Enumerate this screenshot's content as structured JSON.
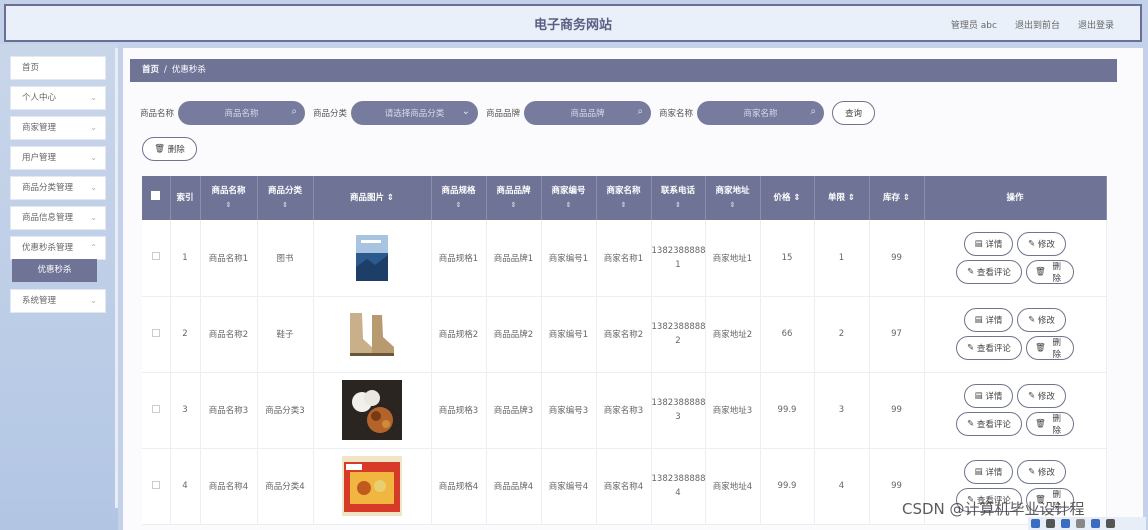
{
  "header": {
    "title": "电子商务网站",
    "admin": "管理员 abc",
    "front": "退出到前台",
    "logout": "退出登录"
  },
  "sidebar": {
    "items": [
      {
        "label": "首页",
        "chevron": false
      },
      {
        "label": "个人中心",
        "chevron": true
      },
      {
        "label": "商家管理",
        "chevron": true
      },
      {
        "label": "用户管理",
        "chevron": true
      },
      {
        "label": "商品分类管理",
        "chevron": true
      },
      {
        "label": "商品信息管理",
        "chevron": true
      },
      {
        "label": "优惠秒杀管理",
        "chevron": true
      },
      {
        "label": "系统管理",
        "chevron": true
      }
    ],
    "active_sub": "优惠秒杀"
  },
  "breadcrumb": {
    "home": "首页",
    "sep": "/",
    "current": "优惠秒杀"
  },
  "filters": {
    "name_label": "商品名称",
    "name_ph": "商品名称",
    "cat_label": "商品分类",
    "cat_ph": "请选择商品分类",
    "brand_label": "商品品牌",
    "brand_ph": "商品品牌",
    "shop_label": "商家名称",
    "shop_ph": "商家名称",
    "query": "查询"
  },
  "delete_label": "删除",
  "table": {
    "headers": {
      "index": "索引",
      "name": "商品名称",
      "cat": "商品分类",
      "img": "商品图片",
      "spec": "商品规格",
      "brand": "商品品牌",
      "shopno": "商家编号",
      "shopname": "商家名称",
      "phone": "联系电话",
      "addr": "商家地址",
      "price": "价格",
      "limit": "单限",
      "stock": "库存",
      "ops": "操作"
    },
    "rows": [
      {
        "index": "1",
        "name": "商品名称1",
        "cat": "图书",
        "spec": "商品规格1",
        "brand": "商品品牌1",
        "shopno": "商家编号1",
        "shopname": "商家名称1",
        "phone1": "1382388888",
        "phone2": "1",
        "addr": "商家地址1",
        "price": "15",
        "limit": "1",
        "stock": "99"
      },
      {
        "index": "2",
        "name": "商品名称2",
        "cat": "鞋子",
        "spec": "商品规格2",
        "brand": "商品品牌2",
        "shopno": "商家编号1",
        "shopname": "商家名称2",
        "phone1": "1382388888",
        "phone2": "2",
        "addr": "商家地址2",
        "price": "66",
        "limit": "2",
        "stock": "97"
      },
      {
        "index": "3",
        "name": "商品名称3",
        "cat": "商品分类3",
        "spec": "商品规格3",
        "brand": "商品品牌3",
        "shopno": "商家编号3",
        "shopname": "商家名称3",
        "phone1": "1382388888",
        "phone2": "3",
        "addr": "商家地址3",
        "price": "99.9",
        "limit": "3",
        "stock": "99"
      },
      {
        "index": "4",
        "name": "商品名称4",
        "cat": "商品分类4",
        "spec": "商品规格4",
        "brand": "商品品牌4",
        "shopno": "商家编号4",
        "shopname": "商家名称4",
        "phone1": "1382388888",
        "phone2": "4",
        "addr": "商家地址4",
        "price": "99.9",
        "limit": "4",
        "stock": "99"
      }
    ],
    "ops": {
      "detail": "详情",
      "edit": "修改",
      "review": "查看评论",
      "del": "删除"
    }
  },
  "watermark": "CSDN @计算机毕业设计程"
}
